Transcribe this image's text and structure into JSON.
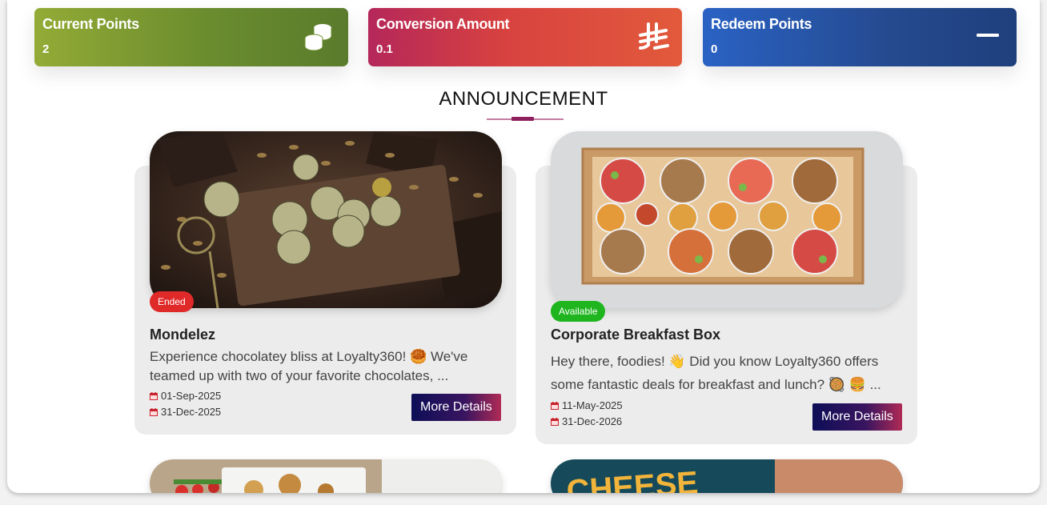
{
  "stats": {
    "current_points": {
      "label": "Current Points",
      "value": "2",
      "icon": "coins-stack-icon",
      "colors": [
        "#93ab36",
        "#5a7b2c"
      ]
    },
    "conversion_amount": {
      "label": "Conversion Amount",
      "value": "0.1",
      "icon": "currency-symbol-icon",
      "colors": [
        "#b5275a",
        "#e25a3c"
      ]
    },
    "redeem_points": {
      "label": "Redeem Points",
      "value": "0",
      "icon": "minus-icon",
      "colors": [
        "#2a62c4",
        "#1f3f7c"
      ]
    }
  },
  "announcement": {
    "heading": "ANNOUNCEMENT",
    "cards": [
      {
        "title": "Mondelez",
        "status": "Ended",
        "description": "Experience chocolatey bliss at Loyalty360! 🥮 We've teamed up with two of your favorite chocolates, ...",
        "start_date": "01-Sep-2025",
        "end_date": "31-Dec-2025",
        "button": "More Details",
        "image": "chocolate-truffles-image"
      },
      {
        "title": "Corporate Breakfast Box",
        "status": "Available",
        "description": "Hey there, foodies! 👋 Did you know Loyalty360 offers some fantastic deals for breakfast and lunch? 🥘 🍔 ...",
        "start_date": "11-May-2025",
        "end_date": "31-Dec-2026",
        "button": "More Details",
        "image": "breakfast-box-image"
      },
      {
        "image": "salad-takeaway-image"
      },
      {
        "image": "cheese-promo-image",
        "partial_text": "CHEESE"
      }
    ]
  },
  "colors": {
    "accent": "#8e1f5e",
    "ended": "#e02a2a",
    "available": "#1fb51f",
    "button_start": "#0d0e57",
    "button_end": "#b02a55"
  }
}
